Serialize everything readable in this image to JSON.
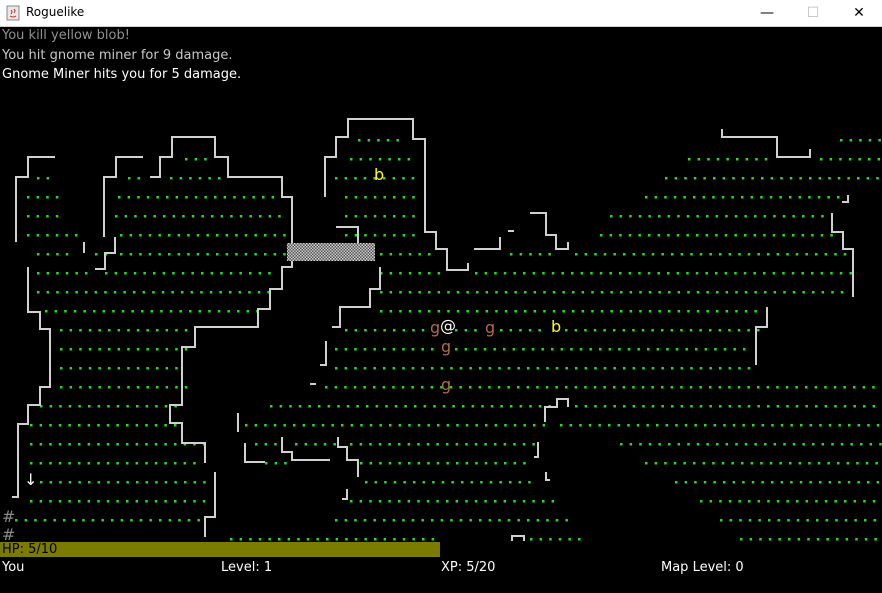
{
  "window": {
    "title": "Roguelike",
    "minimize_glyph": "—",
    "maximize_glyph": "☐",
    "close_glyph": "✕"
  },
  "messages": [
    {
      "text": "You kill yellow blob!",
      "color": "#909090"
    },
    {
      "text": "You hit gnome miner for 9 damage.",
      "color": "#c8c8c8"
    },
    {
      "text": "Gnome Miner hits you for 5 damage.",
      "color": "#ffffff"
    }
  ],
  "colors": {
    "floor": "#22dd22",
    "wall": "#d0d0d0",
    "player": "#ffffff",
    "gnome": "#b06a4a",
    "blob": "#ffff00",
    "hp_bar": "#7b7b00"
  },
  "entities": {
    "player": "@",
    "gnomes": [
      "g",
      "g",
      "g",
      "g"
    ],
    "blobs": [
      "b",
      "b"
    ],
    "stairs_down": "↓",
    "fog_walls": [
      "#",
      "#"
    ]
  },
  "status": {
    "hp_text": "HP: 5/10",
    "hp_fraction": 0.5,
    "name": "You",
    "level": "Level: 1",
    "xp": "XP: 5/20",
    "map_level": "Map Level: 0"
  }
}
